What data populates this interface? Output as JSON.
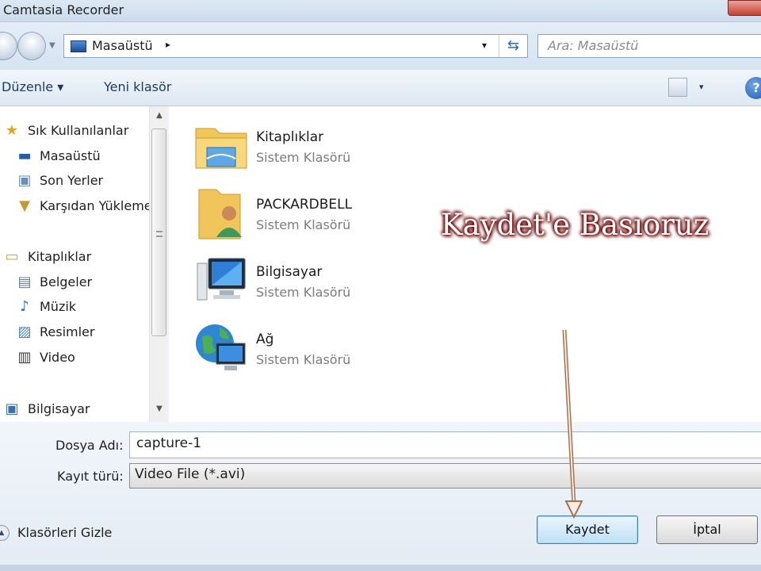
{
  "window": {
    "title": "Camtasia Recorder"
  },
  "address": {
    "crumb": "Masaüstü",
    "separator": "▸",
    "dropdown": "▾",
    "refresh_icon": "refresh-icon"
  },
  "search": {
    "placeholder": "Ara: Masaüstü"
  },
  "toolbar": {
    "organize": "Düzenle ▾",
    "new_folder": "Yeni klasör",
    "view_dropdown": "▾",
    "help": "?"
  },
  "nav": {
    "favorites": {
      "label": "Sık Kullanılanlar",
      "icon": "star-icon"
    },
    "favorites_items": [
      {
        "label": "Masaüstü",
        "icon": "desktop-icon"
      },
      {
        "label": "Son Yerler",
        "icon": "recent-places-icon"
      },
      {
        "label": "Karşıdan Yüklemeler",
        "icon": "downloads-icon"
      }
    ],
    "libraries": {
      "label": "Kitaplıklar",
      "icon": "libraries-icon"
    },
    "libraries_items": [
      {
        "label": "Belgeler",
        "icon": "documents-icon"
      },
      {
        "label": "Müzik",
        "icon": "music-icon"
      },
      {
        "label": "Resimler",
        "icon": "pictures-icon"
      },
      {
        "label": "Video",
        "icon": "video-icon"
      }
    ],
    "computer": {
      "label": "Bilgisayar",
      "icon": "computer-icon"
    }
  },
  "files": [
    {
      "name": "Kitaplıklar",
      "type": "Sistem Klasörü",
      "icon": "libraries-folder-icon"
    },
    {
      "name": "PACKARDBELL",
      "type": "Sistem Klasörü",
      "icon": "user-folder-icon"
    },
    {
      "name": "Bilgisayar",
      "type": "Sistem Klasörü",
      "icon": "computer-icon"
    },
    {
      "name": "Ağ",
      "type": "Sistem Klasörü",
      "icon": "network-icon"
    }
  ],
  "overlay_text": "Kaydet'e Basıoruz",
  "form": {
    "filename_label": "Dosya Adı:",
    "filename_value": "capture-1",
    "filetype_label": "Kayıt türü:",
    "filetype_value": "Video File (*.avi)"
  },
  "footer": {
    "hide_folders": "Klasörleri Gizle",
    "hide_icon": "chevron-up-icon"
  },
  "buttons": {
    "save": "Kaydet",
    "cancel": "İptal"
  },
  "colors": {
    "overlay_text": "#ffffff",
    "overlay_outline": "#7a0000",
    "arrow": "#b87a5a",
    "save_border": "#3c7fb1"
  }
}
